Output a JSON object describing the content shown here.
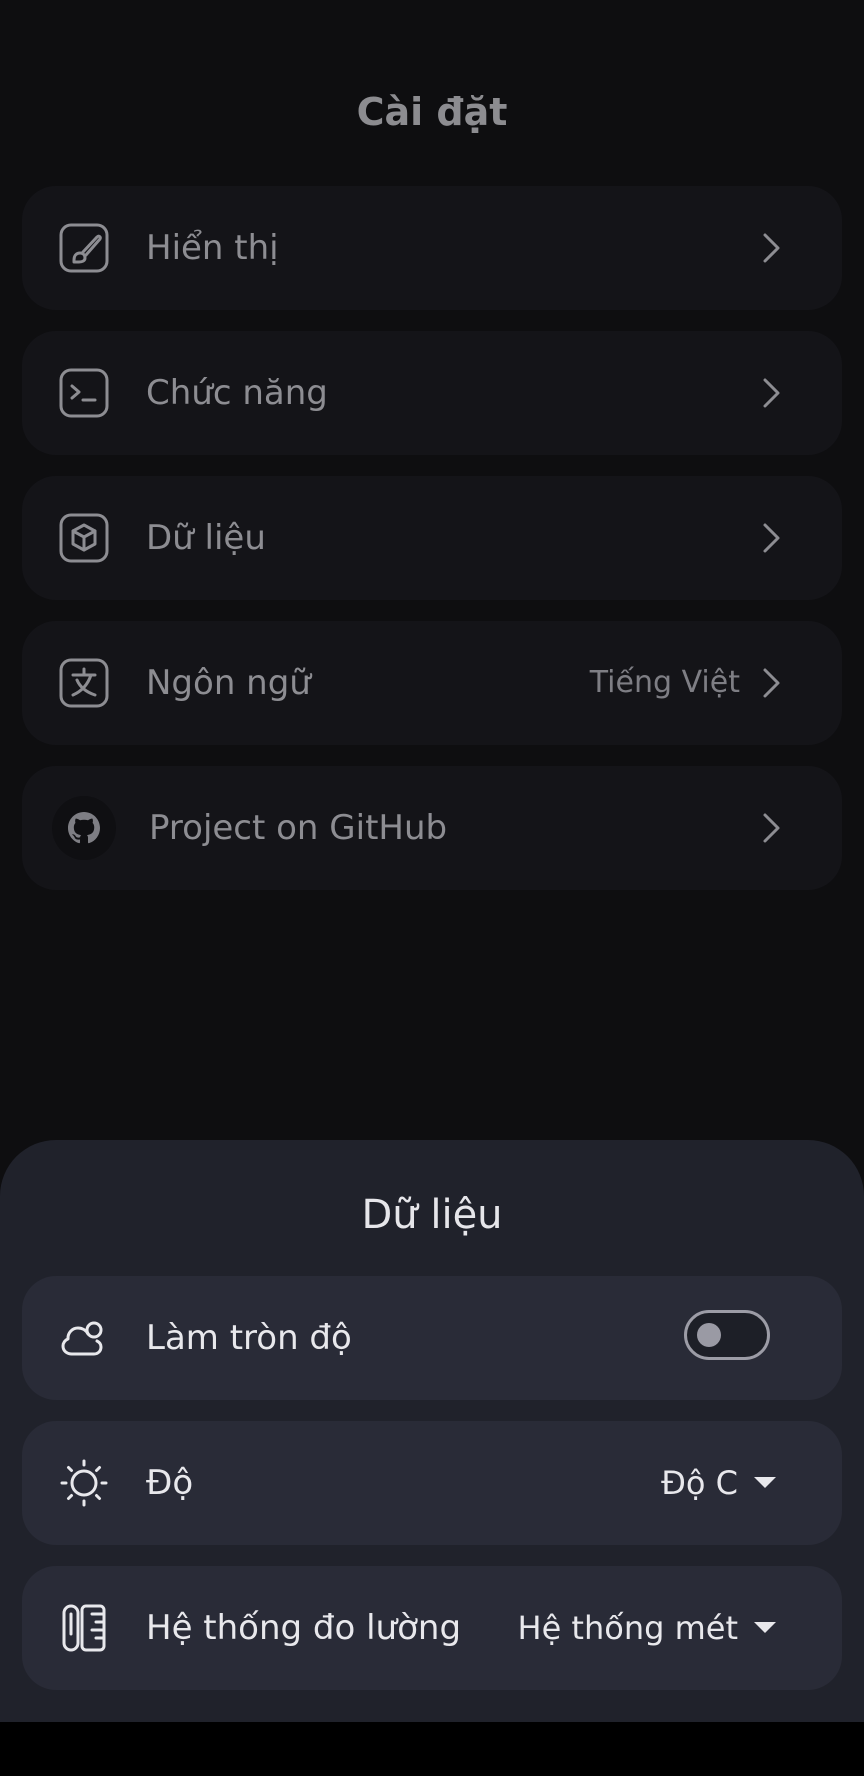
{
  "header": {
    "title": "Cài đặt"
  },
  "settings": {
    "items": [
      {
        "label": "Hiển thị",
        "icon": "brush-icon"
      },
      {
        "label": "Chức năng",
        "icon": "terminal-icon"
      },
      {
        "label": "Dữ liệu",
        "icon": "cube-icon"
      },
      {
        "label": "Ngôn ngữ",
        "icon": "language-icon",
        "value": "Tiếng Việt"
      },
      {
        "label": "Project on GitHub",
        "icon": "github-icon"
      }
    ]
  },
  "sheet": {
    "title": "Dữ liệu",
    "rounding": {
      "label": "Làm tròn độ",
      "icon": "cloud-sun-icon",
      "enabled": false
    },
    "temperature": {
      "label": "Độ",
      "icon": "sun-icon",
      "value": "Độ C"
    },
    "measurement": {
      "label": "Hệ thống đo lường",
      "icon": "ruler-icon",
      "value": "Hệ thống mét"
    }
  },
  "colors": {
    "background": "#0e0e10",
    "card": "#141418",
    "sheet": "#20222b",
    "sheet_card": "#292b37"
  }
}
